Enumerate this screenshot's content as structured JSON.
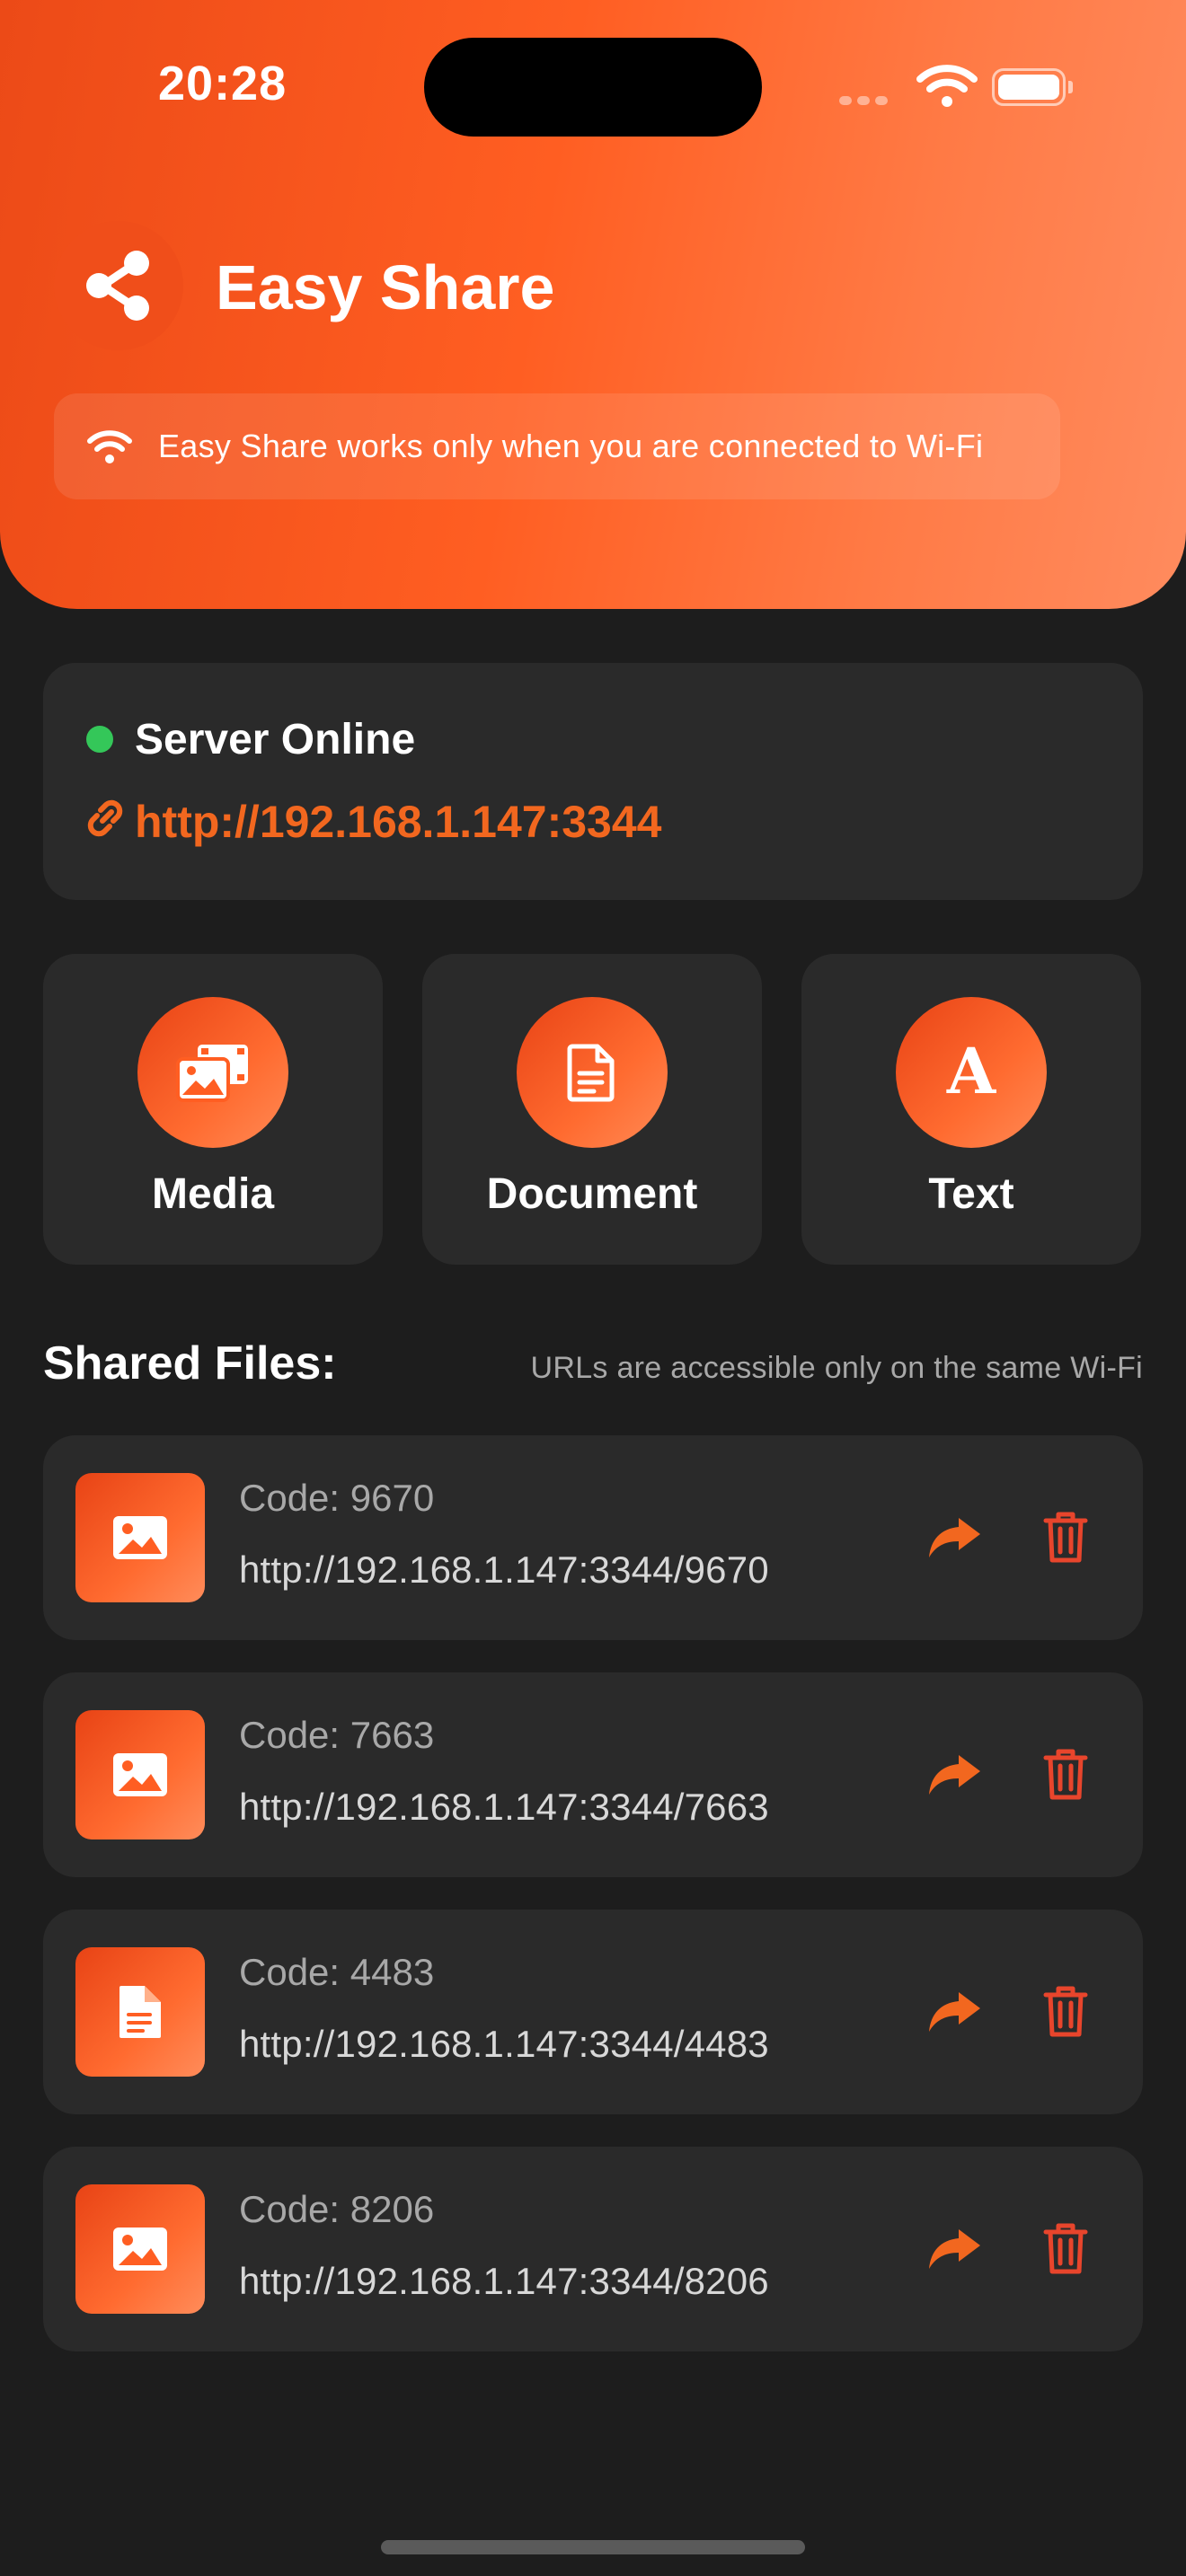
{
  "status_bar": {
    "time": "20:28"
  },
  "header": {
    "app_title": "Easy Share",
    "wifi_notice": "Easy Share works only when you are connected to Wi-Fi"
  },
  "server": {
    "status": "Server Online",
    "url": "http://192.168.1.147:3344"
  },
  "actions": [
    {
      "label": "Media",
      "icon": "media-icon"
    },
    {
      "label": "Document",
      "icon": "document-icon"
    },
    {
      "label": "Text",
      "icon": "text-icon"
    }
  ],
  "shared_files": {
    "title": "Shared Files:",
    "note": "URLs are accessible only on the same Wi-Fi",
    "items": [
      {
        "code": "Code: 9670",
        "url": "http://192.168.1.147:3344/9670",
        "icon": "image-icon"
      },
      {
        "code": "Code: 7663",
        "url": "http://192.168.1.147:3344/7663",
        "icon": "image-icon"
      },
      {
        "code": "Code: 4483",
        "url": "http://192.168.1.147:3344/4483",
        "icon": "file-icon"
      },
      {
        "code": "Code: 8206",
        "url": "http://192.168.1.147:3344/8206",
        "icon": "image-icon"
      }
    ]
  },
  "colors": {
    "accent": "#FF5E22",
    "online": "#34C759",
    "delete": "#E8452C",
    "background": "#1D1D1D",
    "card": "#2A2A2A"
  }
}
